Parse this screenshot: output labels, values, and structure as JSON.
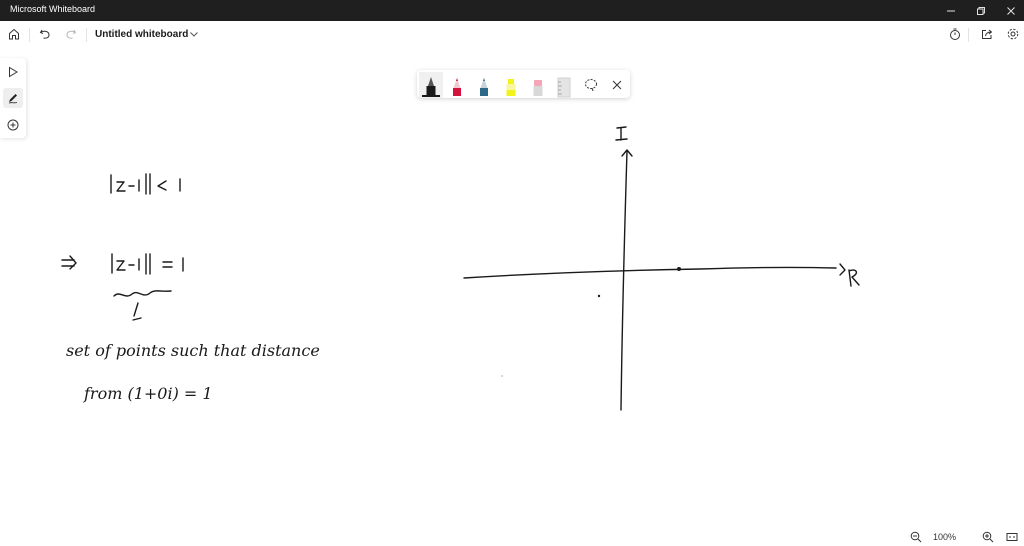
{
  "window": {
    "title": "Microsoft Whiteboard",
    "controls": [
      "minimize",
      "restore",
      "close"
    ]
  },
  "appbar": {
    "home_icon": "home-icon",
    "undo_icon": "undo-icon",
    "redo_icon": "redo-icon",
    "document_title": "Untitled whiteboard",
    "title_dropdown_icon": "chevron-down-icon",
    "right_icons": [
      "timer-icon",
      "share-icon",
      "settings-icon"
    ]
  },
  "left_toolbar": {
    "tools": [
      {
        "name": "select",
        "icon": "pointer-icon",
        "active": false
      },
      {
        "name": "inking",
        "icon": "pen-icon",
        "active": true
      },
      {
        "name": "add",
        "icon": "plus-circle-icon",
        "active": false
      }
    ]
  },
  "pen_tray": {
    "pens": [
      {
        "name": "black-pen",
        "color": "#1a1a1a",
        "active": true
      },
      {
        "name": "red-pen",
        "color": "#d4143c",
        "active": false
      },
      {
        "name": "blue-pen",
        "color": "#2d6a8a",
        "active": false
      },
      {
        "name": "yellow-highlighter",
        "color": "#f2f21c",
        "active": false
      },
      {
        "name": "eraser",
        "color": "#f4a6b8",
        "active": false
      },
      {
        "name": "ruler",
        "color": "#d8d8d8",
        "active": false
      }
    ],
    "lasso_icon": "lasso-icon",
    "close_icon": "close-icon"
  },
  "canvas": {
    "handwriting": {
      "line1": "|z-1| < 1",
      "implies": "⇒",
      "line2": "|z-1| = 1",
      "note_line1": "set of points such that distance",
      "note_line2": "from (1+0i) = 1"
    },
    "axes": {
      "y_label": "I",
      "x_label": "R"
    }
  },
  "zoom": {
    "zoom_out_icon": "zoom-out-icon",
    "level": "100%",
    "zoom_in_icon": "zoom-in-icon",
    "fit_icon": "fit-to-screen-icon"
  }
}
